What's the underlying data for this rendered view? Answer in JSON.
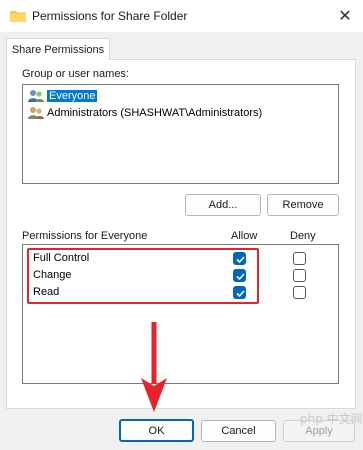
{
  "window": {
    "title": "Permissions for Share Folder",
    "close_glyph": "✕"
  },
  "tab": {
    "label": "Share Permissions"
  },
  "groups": {
    "label": "Group or user names:",
    "items": [
      {
        "name": "Everyone",
        "selected": true
      },
      {
        "name": "Administrators (SHASHWAT\\Administrators)",
        "selected": false
      }
    ],
    "add_label": "Add...",
    "remove_label": "Remove"
  },
  "permissions": {
    "label": "Permissions for Everyone",
    "allow_header": "Allow",
    "deny_header": "Deny",
    "rows": [
      {
        "name": "Full Control",
        "allow": true,
        "deny": false
      },
      {
        "name": "Change",
        "allow": true,
        "deny": false
      },
      {
        "name": "Read",
        "allow": true,
        "deny": false
      }
    ]
  },
  "footer": {
    "ok_label": "OK",
    "cancel_label": "Cancel",
    "apply_label": "Apply"
  },
  "annotations": {
    "highlight_color": "#e8222b",
    "arrow_color": "#e8222b"
  },
  "watermark": "php 中文网"
}
